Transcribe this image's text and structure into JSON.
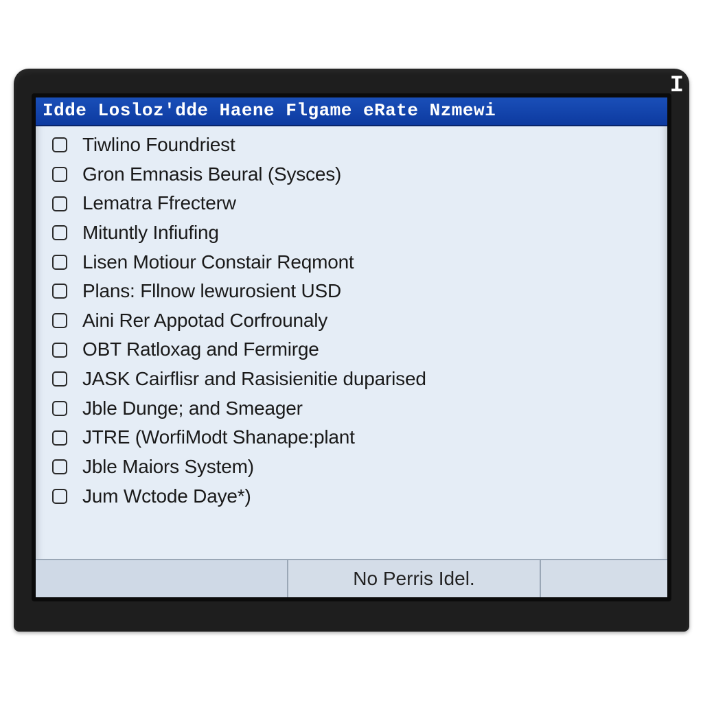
{
  "titleBar": "Idde Losloz'dde Haene Flgame eRate Nzmewi",
  "items": [
    "Tiwlino Foundriest",
    "Gron Emnasis Beural (Sysces)",
    "Lematra Ffrecterw",
    "Mituntly Infiufing",
    "Lisen Motiour Constair Reqmont",
    "Plans: Fllnow lewurosient USD",
    "Aini Rer Appotad Corfrounaly",
    "OBT Ratloxag and Fermirge",
    "JASK Cairflisr and Rasisienitie duparised",
    "Jble Dunge; and Smeager",
    "JTRE (WorfiModt Shanape:plant",
    "Jble Maiors System)",
    "Jum Wctode Daye*)"
  ],
  "statusLabel": "No Perris Idel.",
  "cornerGlyph": "I"
}
